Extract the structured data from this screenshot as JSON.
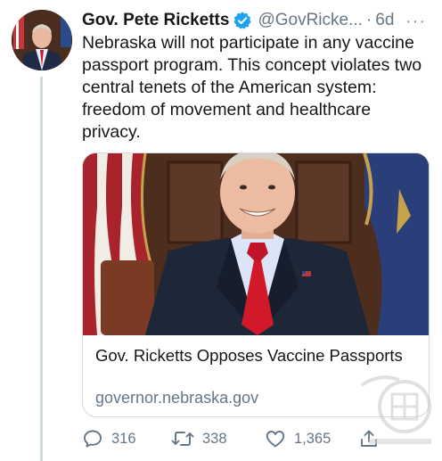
{
  "tweet": {
    "display_name": "Gov. Pete Ricketts",
    "handle": "@GovRicke...",
    "separator": "·",
    "time": "6d",
    "more_label": "···",
    "text": "Nebraska will not participate in any vaccine passport program. This concept violates two central tenets of the American system: freedom of movement and healthcare privacy."
  },
  "card": {
    "title": "Gov. Ricketts Opposes Vaccine Passports",
    "domain": "governor.nebraska.gov"
  },
  "actions": {
    "reply_count": "316",
    "retweet_count": "338",
    "like_count": "1,365"
  },
  "icons": {
    "verified": "verified-badge-icon",
    "reply": "speech-bubble-icon",
    "retweet": "retweet-arrows-icon",
    "like": "heart-icon",
    "share": "share-icon"
  },
  "colors": {
    "verified": "#1da1f2",
    "muted": "#657786",
    "text": "#14171a",
    "tie": "#d1192a"
  }
}
